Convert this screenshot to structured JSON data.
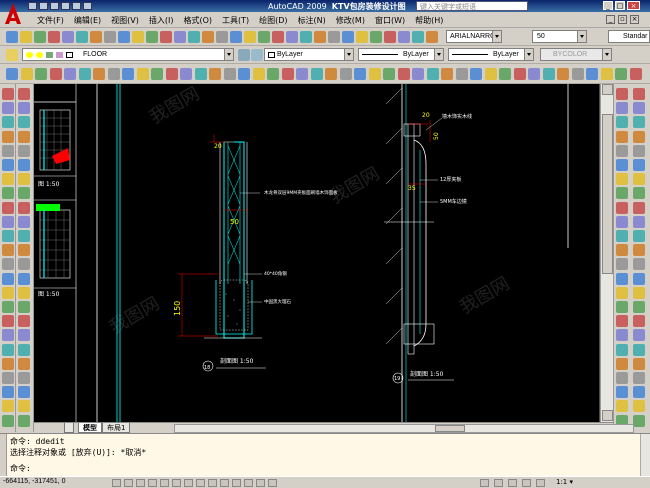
{
  "window": {
    "title_app": "AutoCAD 2009",
    "title_file": "KTV包房装修设计图",
    "help_placeholder": "键入关键字或短语"
  },
  "menu": [
    "文件(F)",
    "编辑(E)",
    "视图(V)",
    "插入(I)",
    "格式(O)",
    "工具(T)",
    "绘图(D)",
    "标注(N)",
    "修改(M)",
    "窗口(W)",
    "帮助(H)"
  ],
  "toolbar_text": {
    "text_style": "ARIALNARROW",
    "text_height": "50",
    "dim_style": "Standar",
    "layer": "FLOOR",
    "color": "ByLayer",
    "linetype": "ByLayer",
    "lineweight": "ByLayer",
    "plotstyle": "BYCOLOR"
  },
  "drawing": {
    "left_label_1": "图 1:50",
    "left_label_2": "图 1:50",
    "mid": {
      "dim_top": "20",
      "dim_50": "50",
      "dim_150": "150",
      "note_1": "木龙骨双层9MM夹板面刷墙木饰面板",
      "note_2": "40*40角钢",
      "note_3": "中国黑大理石",
      "section_no": "18",
      "section_label": "剖面图  1:50"
    },
    "right": {
      "dim_20": "20",
      "dim_50": "50",
      "dim_35": "35",
      "note_1": "墙木饰实木线",
      "note_2": "12厚夹板",
      "note_3": "5MM车边镜",
      "section_no": "19",
      "section_label": "剖面图  1:50"
    },
    "watermark": "我图网"
  },
  "tabs": [
    "模型",
    "布局1"
  ],
  "command": {
    "line1": "命令:  ddedit",
    "line2": "选择注释对象或 [放弃(U)]: *取消*",
    "line3": "命令:"
  },
  "status": {
    "coords": "-664115, -317451, 0",
    "scale": "1:1"
  },
  "colors": {
    "canvas": "#000000",
    "cyan": "#00ffff",
    "red": "#ff0000",
    "green": "#00ff00",
    "yellow": "#ffff00",
    "white": "#ffffff"
  }
}
